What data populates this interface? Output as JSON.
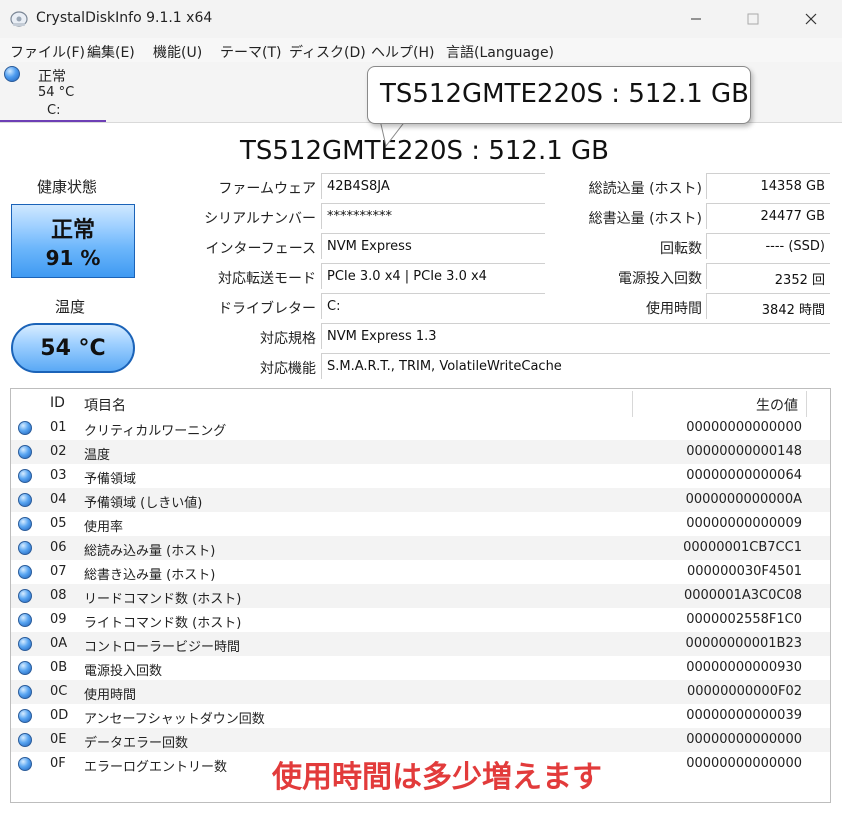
{
  "window": {
    "title": "CrystalDiskInfo 9.1.1 x64",
    "minimize_icon": "minimize-icon",
    "maximize_icon": "maximize-icon",
    "close_icon": "close-icon"
  },
  "menu": [
    "ファイル(F)",
    "編集(E)",
    "機能(U)",
    "テーマ(T)",
    "ディスク(D)",
    "ヘルプ(H)",
    "言語(Language)"
  ],
  "disk_tab": {
    "status": "正常",
    "temperature": "54 °C",
    "letter": "C:"
  },
  "tooltip": {
    "text": "TS512GMTE220S : 512.1 GB"
  },
  "model_title": "TS512GMTE220S : 512.1 GB",
  "health": {
    "label": "健康状態",
    "status": "正常",
    "percent": "91 %"
  },
  "temperature": {
    "label": "温度",
    "value": "54 °C"
  },
  "info_left": [
    {
      "label": "ファームウェア",
      "value": "42B4S8JA"
    },
    {
      "label": "シリアルナンバー",
      "value": "**********"
    },
    {
      "label": "インターフェース",
      "value": "NVM Express"
    },
    {
      "label": "対応転送モード",
      "value": "PCIe 3.0 x4 | PCIe 3.0 x4"
    },
    {
      "label": "ドライブレター",
      "value": "C:"
    }
  ],
  "info_right": [
    {
      "label": "総読込量 (ホスト)",
      "value": "14358 GB"
    },
    {
      "label": "総書込量 (ホスト)",
      "value": "24477 GB"
    },
    {
      "label": "回転数",
      "value": "---- (SSD)"
    },
    {
      "label": "電源投入回数",
      "value": "2352 回"
    },
    {
      "label": "使用時間",
      "value": "3842 時間"
    }
  ],
  "info_wide": [
    {
      "label": "対応規格",
      "value": "NVM Express 1.3"
    },
    {
      "label": "対応機能",
      "value": "S.M.A.R.T., TRIM, VolatileWriteCache"
    }
  ],
  "smart_table": {
    "columns": {
      "id": "ID",
      "name": "項目名",
      "raw": "生の値"
    },
    "rows": [
      {
        "id": "01",
        "name": "クリティカルワーニング",
        "raw": "00000000000000"
      },
      {
        "id": "02",
        "name": "温度",
        "raw": "00000000000148"
      },
      {
        "id": "03",
        "name": "予備領域",
        "raw": "00000000000064"
      },
      {
        "id": "04",
        "name": "予備領域 (しきい値)",
        "raw": "0000000000000A"
      },
      {
        "id": "05",
        "name": "使用率",
        "raw": "00000000000009"
      },
      {
        "id": "06",
        "name": "総読み込み量 (ホスト)",
        "raw": "00000001CB7CC1"
      },
      {
        "id": "07",
        "name": "総書き込み量 (ホスト)",
        "raw": "000000030F4501"
      },
      {
        "id": "08",
        "name": "リードコマンド数 (ホスト)",
        "raw": "0000001A3C0C08"
      },
      {
        "id": "09",
        "name": "ライトコマンド数 (ホスト)",
        "raw": "0000002558F1C0"
      },
      {
        "id": "0A",
        "name": "コントローラービジー時間",
        "raw": "00000000001B23"
      },
      {
        "id": "0B",
        "name": "電源投入回数",
        "raw": "00000000000930"
      },
      {
        "id": "0C",
        "name": "使用時間",
        "raw": "00000000000F02"
      },
      {
        "id": "0D",
        "name": "アンセーフシャットダウン回数",
        "raw": "00000000000039"
      },
      {
        "id": "0E",
        "name": "データエラー回数",
        "raw": "00000000000000"
      },
      {
        "id": "0F",
        "name": "エラーログエントリー数",
        "raw": "00000000000000"
      }
    ]
  },
  "annotation": "使用時間は多少増えます",
  "colors": {
    "health_blue": "#4fa3f5",
    "annotation_red": "#e23b3b",
    "tab_accent": "#6d3fb5"
  }
}
